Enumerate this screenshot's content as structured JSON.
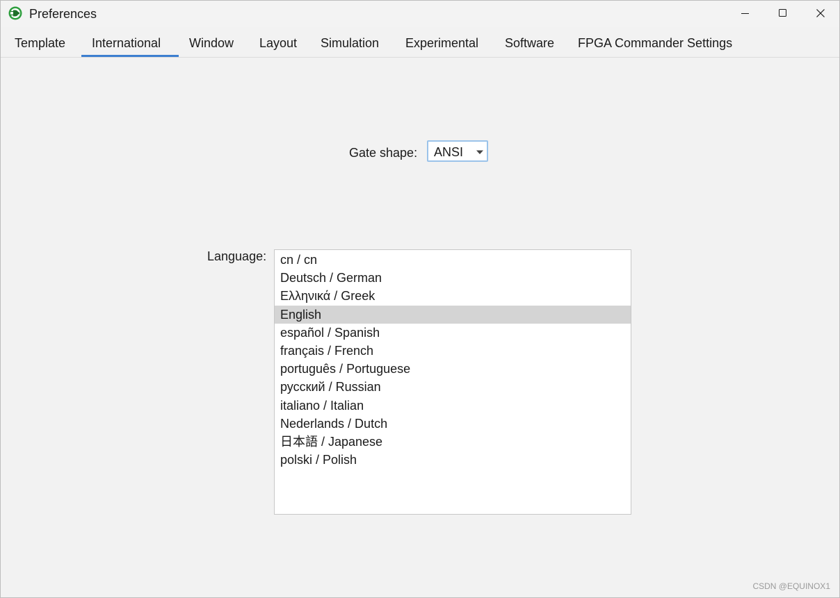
{
  "window": {
    "title": "Preferences"
  },
  "tabs": [
    {
      "label": "Template"
    },
    {
      "label": "International",
      "active": true
    },
    {
      "label": "Window"
    },
    {
      "label": "Layout"
    },
    {
      "label": "Simulation"
    },
    {
      "label": "Experimental"
    },
    {
      "label": "Software"
    },
    {
      "label": "FPGA Commander Settings"
    }
  ],
  "international": {
    "gate_shape_label": "Gate shape:",
    "gate_shape_value": "ANSI",
    "language_label": "Language:",
    "languages": [
      {
        "label": "cn / cn"
      },
      {
        "label": "Deutsch / German"
      },
      {
        "label": "Ελληνικά / Greek"
      },
      {
        "label": "English",
        "selected": true
      },
      {
        "label": "español / Spanish"
      },
      {
        "label": "français / French"
      },
      {
        "label": "português / Portuguese"
      },
      {
        "label": "русский / Russian"
      },
      {
        "label": "italiano / Italian"
      },
      {
        "label": "Nederlands / Dutch"
      },
      {
        "label": "日本語 / Japanese"
      },
      {
        "label": "polski / Polish"
      }
    ]
  },
  "watermark": "CSDN @EQUINOX1",
  "colors": {
    "accent": "#3d7fd0",
    "selection": "#d4d4d4",
    "background": "#f2f2f2",
    "app_icon": "#2e9e3e"
  },
  "icons": {
    "app": "app-icon",
    "minimize": "minimize-icon",
    "maximize": "maximize-icon",
    "close": "close-icon",
    "dropdown": "chevron-down-icon"
  }
}
